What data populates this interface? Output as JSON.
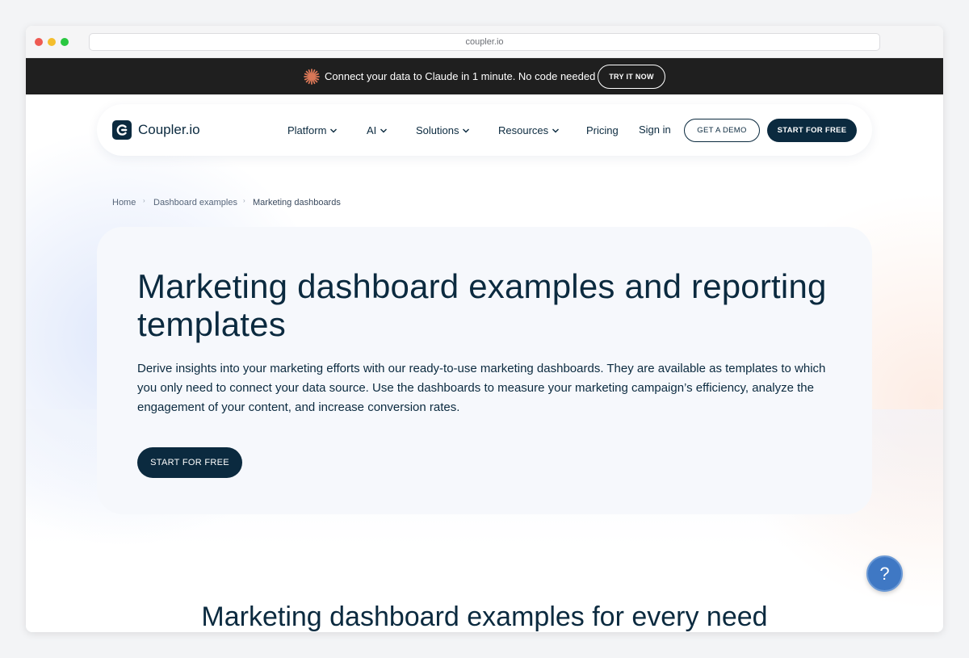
{
  "browser": {
    "url": "coupler.io"
  },
  "promo": {
    "text": "Connect your data to Claude in 1 minute. No code needed",
    "button": "TRY IT NOW",
    "icon": "claude-starburst-icon",
    "accent": "#d97757"
  },
  "nav": {
    "logo": "Coupler.io",
    "items": [
      {
        "label": "Platform",
        "dropdown": true
      },
      {
        "label": "AI",
        "dropdown": true
      },
      {
        "label": "Solutions",
        "dropdown": true
      },
      {
        "label": "Resources",
        "dropdown": true
      },
      {
        "label": "Pricing",
        "dropdown": false
      }
    ],
    "sign_in": "Sign in",
    "demo_button": "GET A DEMO",
    "start_button": "START FOR FREE"
  },
  "breadcrumb": [
    "Home",
    "Dashboard examples",
    "Marketing dashboards"
  ],
  "hero": {
    "title": "Marketing dashboard examples and reporting templates",
    "description": "Derive insights into your marketing efforts with our ready-to-use marketing dashboards. They are available as templates to which you only need to connect your data source. Use the dashboards to measure your marketing campaign’s efficiency, analyze the engagement of your content, and increase conversion rates.",
    "button": "START FOR FREE"
  },
  "section": {
    "title": "Marketing dashboard examples for every need"
  },
  "help": {
    "label": "?"
  },
  "colors": {
    "brand_dark": "#0b2a3f",
    "promo_bg": "#1f1f1f",
    "card_purple": "#dcdcfb",
    "card_peach": "#fbe3d9",
    "card_cyan": "#d4f0f8",
    "help_blue": "#3f78c4"
  }
}
